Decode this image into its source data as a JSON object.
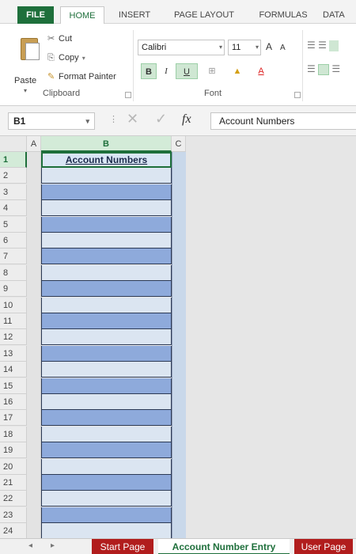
{
  "ribbon_tabs": [
    "FILE",
    "HOME",
    "INSERT",
    "PAGE LAYOUT",
    "FORMULAS",
    "DATA"
  ],
  "active_tab": "HOME",
  "clipboard": {
    "paste": "Paste",
    "cut": "Cut",
    "copy": "Copy",
    "format_painter": "Format Painter",
    "group_label": "Clipboard"
  },
  "font": {
    "family": "Calibri",
    "size": "11",
    "group_label": "Font",
    "bold": "B",
    "italic": "I",
    "underline": "U",
    "grow": "A",
    "shrink": "A",
    "font_color": "A"
  },
  "formula_bar": {
    "name_box": "B1",
    "fx": "fx",
    "content": "Account Numbers"
  },
  "grid": {
    "columns": [
      "A",
      "B",
      "C"
    ],
    "selected_column": "B",
    "rows": [
      "1",
      "2",
      "3",
      "4",
      "5",
      "6",
      "7",
      "8",
      "9",
      "10",
      "11",
      "12",
      "13",
      "14",
      "15",
      "16",
      "17",
      "18",
      "19",
      "20",
      "21",
      "22",
      "23",
      "24"
    ],
    "header_cell": "Account Numbers"
  },
  "sheet_tabs": {
    "tabs": [
      "Start Page",
      "Account Number Entry",
      "User Page"
    ],
    "active": "Account Number Entry"
  },
  "colors": {
    "excel_green": "#1e6f3b",
    "tab_red": "#b11d1d",
    "band_light": "#dbe5f1",
    "band_dark": "#8eaadb"
  }
}
